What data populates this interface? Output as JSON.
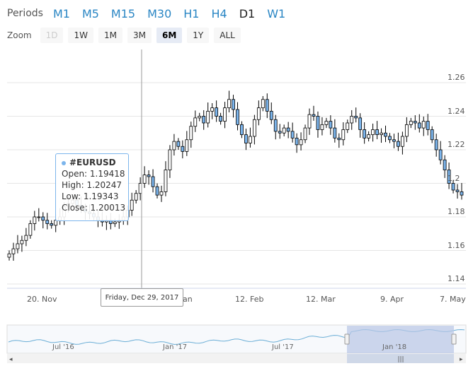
{
  "periods": {
    "label": "Periods",
    "items": [
      "M1",
      "M5",
      "M15",
      "M30",
      "H1",
      "H4",
      "D1",
      "W1"
    ],
    "active": "D1"
  },
  "zoom": {
    "label": "Zoom",
    "items": [
      "1D",
      "1W",
      "1M",
      "3M",
      "6M",
      "1Y",
      "ALL"
    ],
    "active": "6M",
    "disabled": [
      "1D"
    ]
  },
  "tooltip": {
    "symbol": "#EURUSD",
    "open": "Open: 1.19418",
    "high": "High: 1.20247",
    "low": "Low: 1.19343",
    "close": "Close: 1.20013"
  },
  "crosshair_date": "Friday, Dec 29, 2017",
  "x_labels": [
    "20. Nov",
    "12. Feb",
    "12. Mar",
    "9. Apr",
    "7. May"
  ],
  "x_label_partial": "an",
  "navigator_labels": [
    "Jul '16",
    "Jan '17",
    "Jul '17",
    "Jan '18"
  ],
  "chart_data": {
    "type": "candlestick",
    "symbol": "#EURUSD",
    "ylim": [
      1.14,
      1.26
    ],
    "yticks": [
      "1.14",
      "1.16",
      "1.18",
      "1.2",
      "1.22",
      "1.24",
      "1.26"
    ],
    "candles_start": "2017-11-08",
    "candles_end": "2018-05-10",
    "closes": [
      1.158,
      1.161,
      1.164,
      1.166,
      1.169,
      1.176,
      1.18,
      1.18,
      1.178,
      1.176,
      1.175,
      1.178,
      1.18,
      1.186,
      1.188,
      1.19,
      1.187,
      1.185,
      1.183,
      1.182,
      1.18,
      1.178,
      1.177,
      1.178,
      1.176,
      1.177,
      1.178,
      1.18,
      1.184,
      1.19,
      1.194,
      1.2,
      1.205,
      1.204,
      1.198,
      1.193,
      1.195,
      1.208,
      1.22,
      1.225,
      1.222,
      1.219,
      1.226,
      1.234,
      1.239,
      1.24,
      1.236,
      1.243,
      1.245,
      1.24,
      1.237,
      1.245,
      1.25,
      1.244,
      1.235,
      1.229,
      1.224,
      1.228,
      1.238,
      1.245,
      1.25,
      1.243,
      1.238,
      1.231,
      1.23,
      1.233,
      1.231,
      1.227,
      1.223,
      1.226,
      1.233,
      1.241,
      1.24,
      1.232,
      1.235,
      1.237,
      1.233,
      1.227,
      1.226,
      1.232,
      1.236,
      1.24,
      1.239,
      1.232,
      1.227,
      1.229,
      1.232,
      1.229,
      1.23,
      1.228,
      1.226,
      1.225,
      1.222,
      1.228,
      1.235,
      1.237,
      1.236,
      1.233,
      1.237,
      1.232,
      1.226,
      1.22,
      1.214,
      1.208,
      1.2,
      1.196,
      1.195,
      1.193
    ]
  },
  "navigator": {
    "range": "Jul '16 to Jan '18",
    "selected_range": "last 6 months"
  }
}
